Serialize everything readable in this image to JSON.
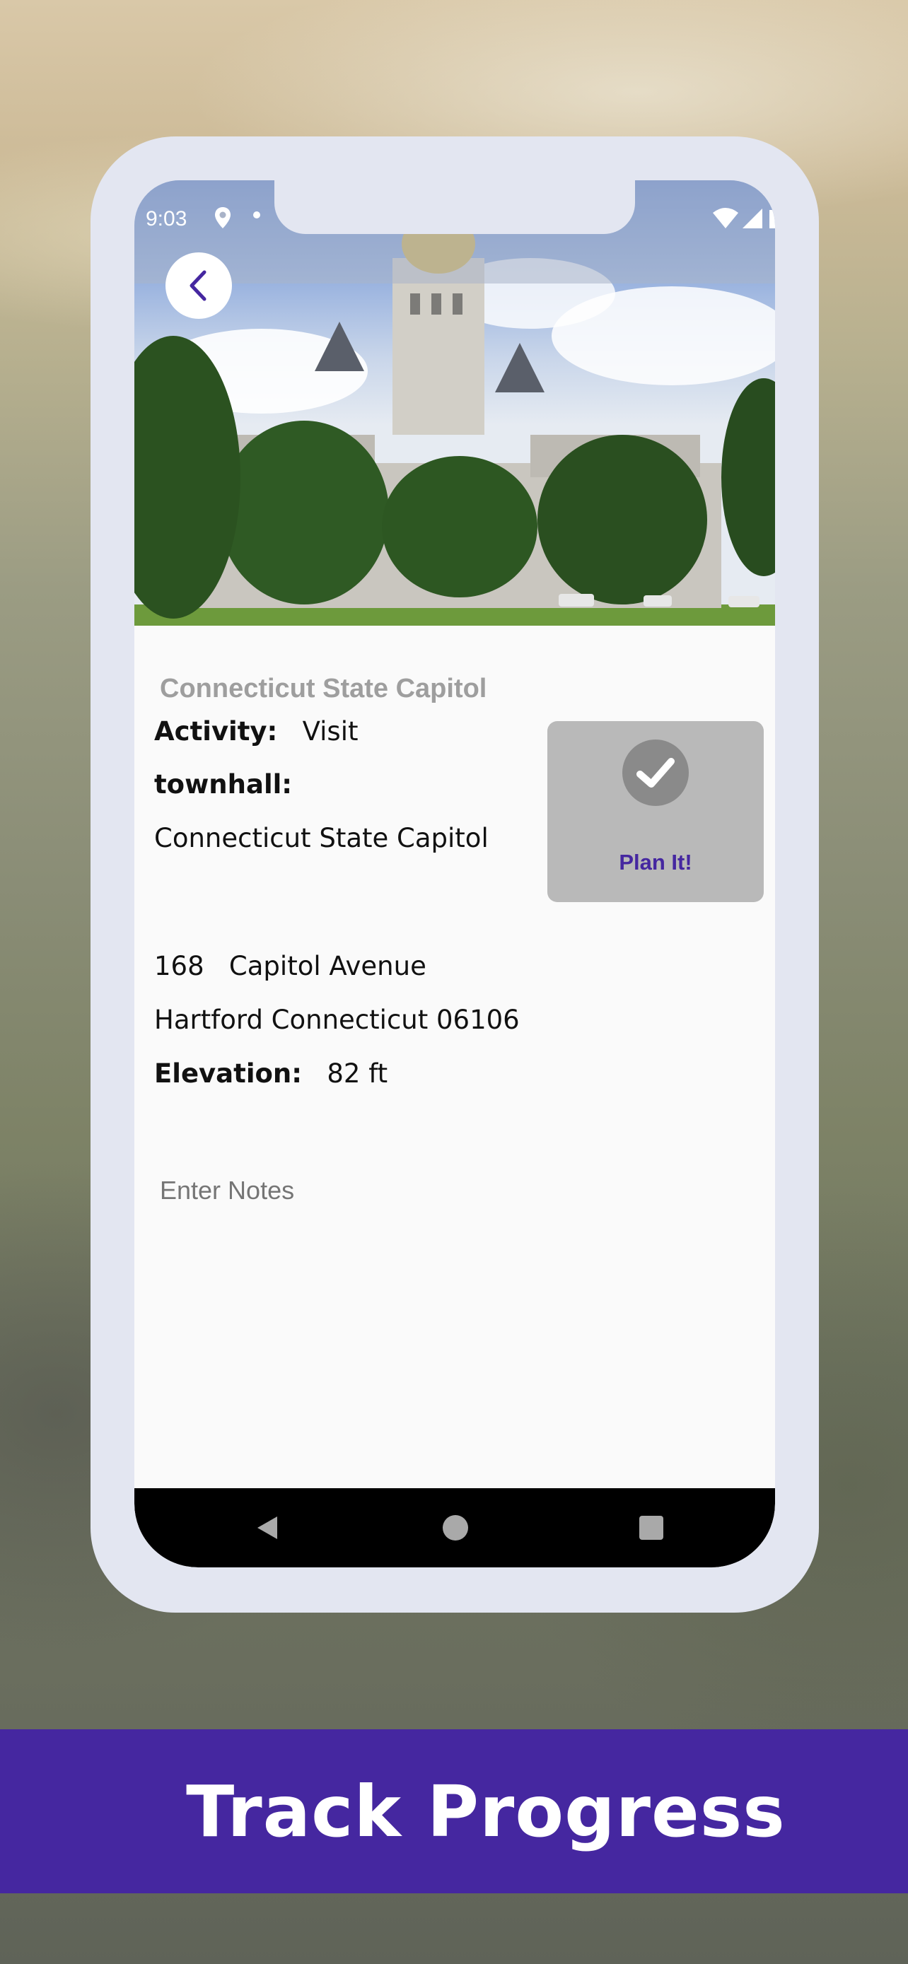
{
  "status": {
    "time": "9:03"
  },
  "place": {
    "title": "Connecticut State Capitol",
    "activity_label": "Activity:",
    "activity_value": "Visit",
    "townhall_label": "townhall:",
    "townhall_value": "Connecticut State Capitol",
    "address_number": "168",
    "address_street": "Capitol Avenue",
    "city_line": "Hartford Connecticut 06106",
    "elevation_label": "Elevation:",
    "elevation_value": "82 ft"
  },
  "plan": {
    "label": "Plan It!"
  },
  "notes": {
    "placeholder": "Enter Notes"
  },
  "banner": {
    "text": "Track Progress"
  },
  "colors": {
    "accent": "#4527a0",
    "phone_frame": "#e3e6f1",
    "plan_card": "#b9b9b9"
  }
}
